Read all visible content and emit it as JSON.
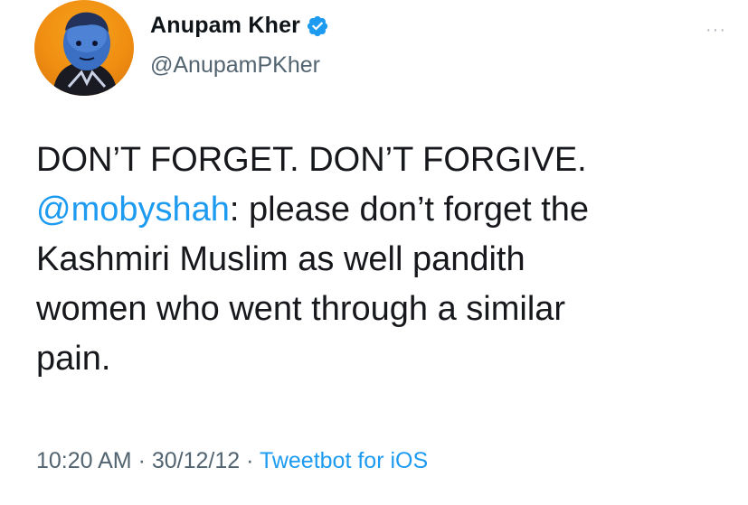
{
  "author": {
    "display_name": "Anupam Kher",
    "handle": "@AnupamPKher",
    "verified": true
  },
  "more_menu_glyph": "···",
  "tweet": {
    "lines": [
      {
        "text": "DON’T FORGET. DON’T FORGIVE."
      },
      {
        "mention": "@mobyshah",
        "text": ": please don’t forget the"
      },
      {
        "text": "Kashmiri Muslim as well pandith"
      },
      {
        "text": "women who went through a similar"
      },
      {
        "text": "pain."
      }
    ]
  },
  "meta": {
    "time": "10:20 AM",
    "separator": " · ",
    "date": "30/12/12",
    "source": "Tweetbot for iOS"
  },
  "colors": {
    "link": "#1d9bf0",
    "secondary_text": "#536471",
    "verified_badge": "#1d9bf0",
    "avatar_background": "#f08e12"
  },
  "icons": {
    "avatar": "profile-photo",
    "verified": "verified-badge-icon",
    "more": "more-options-icon"
  }
}
